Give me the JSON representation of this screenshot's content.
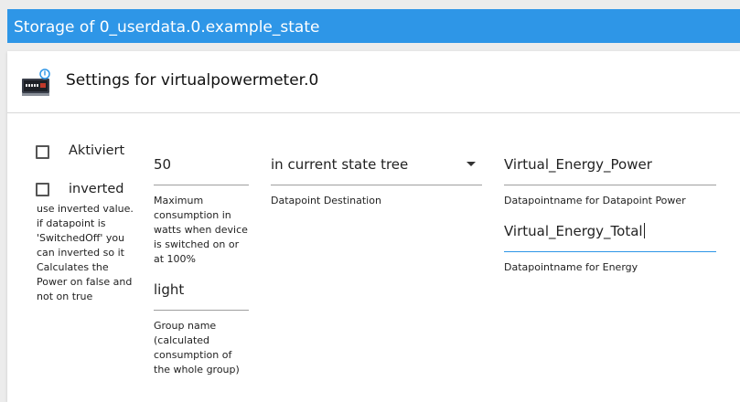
{
  "storage_bar": {
    "title": "Storage of 0_userdata.0.example_state"
  },
  "panel": {
    "title": "Settings for virtualpowermeter.0"
  },
  "checkboxes": {
    "aktiviert": {
      "label": "Aktiviert",
      "checked": false
    },
    "inverted": {
      "label": "inverted",
      "checked": false,
      "helper": "use inverted value. if datapoint is 'SwitchedOff' you can inverted so it Calculates the Power on false and not on true"
    }
  },
  "fields": {
    "max_consumption": {
      "value": "50",
      "hint": "Maximum consumption in watts when device is switched on or at 100%"
    },
    "group_name": {
      "value": "light",
      "hint": "Group name (calculated consumption of the whole group)"
    },
    "datapoint_destination": {
      "value": "in current state tree",
      "hint": "Datapoint Destination"
    },
    "datapoint_power": {
      "value": "Virtual_Energy_Power",
      "hint": "Datapointname for Datapoint Power"
    },
    "datapoint_energy": {
      "value": "Virtual_Energy_Total",
      "hint": "Datapointname for Energy"
    }
  },
  "colors": {
    "accent": "#2e96e7",
    "background": "#ececec"
  },
  "icons": {
    "logo": "virtual-power-meter-logo-icon",
    "dropdown": "chevron-down-icon"
  }
}
